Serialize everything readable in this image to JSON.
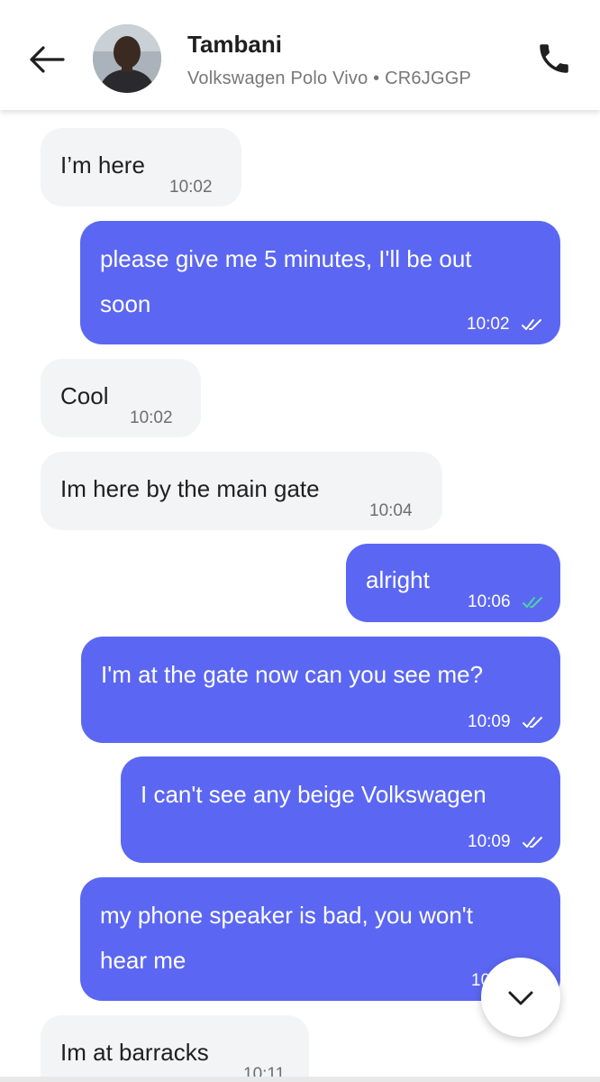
{
  "header": {
    "name": "Tambani",
    "vehicle": "Volkswagen Polo Vivo • CR6JGGP"
  },
  "messages": [
    {
      "dir": "in",
      "lines": [
        "I’m here"
      ],
      "time": "10:02"
    },
    {
      "dir": "out",
      "lines": [
        "please give me 5 minutes, I'll be out",
        "soon"
      ],
      "time": "10:02",
      "read": false
    },
    {
      "dir": "in",
      "lines": [
        "Cool"
      ],
      "time": "10:02"
    },
    {
      "dir": "in",
      "lines": [
        "Im here by the main gate"
      ],
      "time": "10:04"
    },
    {
      "dir": "out",
      "lines": [
        "alright"
      ],
      "time": "10:06",
      "read": true
    },
    {
      "dir": "out",
      "lines": [
        "I'm at the gate now can you see me?"
      ],
      "time": "10:09",
      "read": false
    },
    {
      "dir": "out",
      "lines": [
        "I can't see any beige Volkswagen"
      ],
      "time": "10:09",
      "read": false
    },
    {
      "dir": "out",
      "lines": [
        "my phone speaker is bad, you won't",
        "hear me"
      ],
      "time": "10:10",
      "read": false
    },
    {
      "dir": "in",
      "lines": [
        "Im at barracks"
      ],
      "time": "10:11"
    }
  ],
  "colors": {
    "outgoing_bubble": "#5b67f2",
    "incoming_bubble": "#f3f4f6",
    "read_tick": "#4fd1a5",
    "sent_tick": "#ffffff"
  },
  "icons": {
    "back": "arrow-left-icon",
    "call": "phone-icon",
    "scroll": "chevron-down-icon"
  }
}
